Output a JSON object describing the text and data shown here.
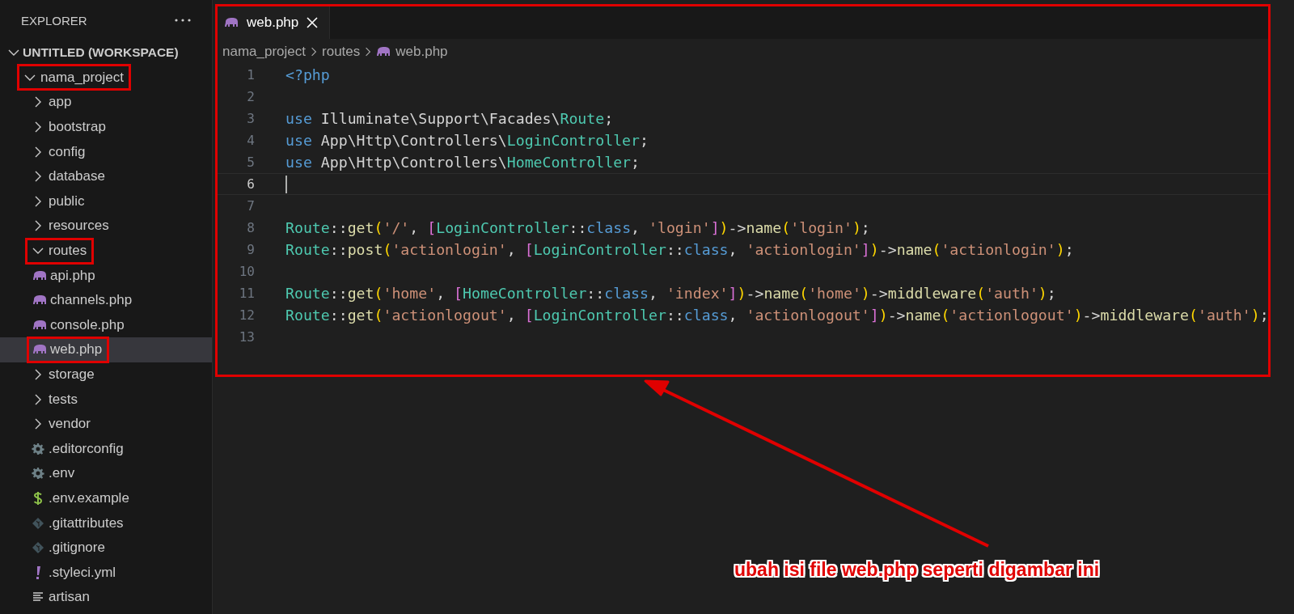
{
  "sidebar": {
    "title": "EXPLORER",
    "workspace": {
      "label": "UNTITLED (WORKSPACE)",
      "expanded": true
    },
    "tree": [
      {
        "label": "nama_project",
        "kind": "folder",
        "expanded": true,
        "selected": false,
        "highlighted": true,
        "children": [
          {
            "label": "app",
            "kind": "folder",
            "expanded": false,
            "selected": false,
            "highlighted": false
          },
          {
            "label": "bootstrap",
            "kind": "folder",
            "expanded": false,
            "selected": false,
            "highlighted": false
          },
          {
            "label": "config",
            "kind": "folder",
            "expanded": false,
            "selected": false,
            "highlighted": false
          },
          {
            "label": "database",
            "kind": "folder",
            "expanded": false,
            "selected": false,
            "highlighted": false
          },
          {
            "label": "public",
            "kind": "folder",
            "expanded": false,
            "selected": false,
            "highlighted": false
          },
          {
            "label": "resources",
            "kind": "folder",
            "expanded": false,
            "selected": false,
            "highlighted": false
          },
          {
            "label": "routes",
            "kind": "folder",
            "expanded": true,
            "selected": false,
            "highlighted": true,
            "children": [
              {
                "label": "api.php",
                "kind": "php",
                "selected": false,
                "highlighted": false
              },
              {
                "label": "channels.php",
                "kind": "php",
                "selected": false,
                "highlighted": false
              },
              {
                "label": "console.php",
                "kind": "php",
                "selected": false,
                "highlighted": false
              },
              {
                "label": "web.php",
                "kind": "php",
                "selected": true,
                "highlighted": true
              }
            ]
          },
          {
            "label": "storage",
            "kind": "folder",
            "expanded": false,
            "selected": false,
            "highlighted": false
          },
          {
            "label": "tests",
            "kind": "folder",
            "expanded": false,
            "selected": false,
            "highlighted": false
          },
          {
            "label": "vendor",
            "kind": "folder",
            "expanded": false,
            "selected": false,
            "highlighted": false
          },
          {
            "label": ".editorconfig",
            "kind": "config",
            "selected": false,
            "highlighted": false
          },
          {
            "label": ".env",
            "kind": "config",
            "selected": false,
            "highlighted": false
          },
          {
            "label": ".env.example",
            "kind": "env",
            "selected": false,
            "highlighted": false
          },
          {
            "label": ".gitattributes",
            "kind": "git",
            "selected": false,
            "highlighted": false
          },
          {
            "label": ".gitignore",
            "kind": "git",
            "selected": false,
            "highlighted": false
          },
          {
            "label": ".styleci.yml",
            "kind": "yaml",
            "selected": false,
            "highlighted": false
          },
          {
            "label": "artisan",
            "kind": "text",
            "selected": false,
            "highlighted": false
          }
        ]
      }
    ]
  },
  "editor": {
    "highlighted": true,
    "tabs": [
      {
        "label": "web.php",
        "selected": true
      }
    ],
    "breadcrumb": [
      "nama_project",
      "routes",
      "web.php"
    ],
    "lines": [
      {
        "number": "1",
        "current": false,
        "tokens": [
          {
            "kind": "keyword",
            "text": "<?php"
          }
        ]
      },
      {
        "number": "2",
        "current": false
      },
      {
        "number": "3",
        "current": false,
        "tokens": [
          {
            "kind": "keyword",
            "text": "use"
          },
          {
            "kind": "plain",
            "text": " Illuminate\\Support\\Facades\\"
          },
          {
            "kind": "class",
            "text": "Route"
          },
          {
            "kind": "plain",
            "text": ";"
          }
        ]
      },
      {
        "number": "4",
        "current": false,
        "tokens": [
          {
            "kind": "keyword",
            "text": "use"
          },
          {
            "kind": "plain",
            "text": " App\\Http\\Controllers\\"
          },
          {
            "kind": "class",
            "text": "LoginController"
          },
          {
            "kind": "plain",
            "text": ";"
          }
        ]
      },
      {
        "number": "5",
        "current": false,
        "tokens": [
          {
            "kind": "keyword",
            "text": "use"
          },
          {
            "kind": "plain",
            "text": " App\\Http\\Controllers\\"
          },
          {
            "kind": "class",
            "text": "HomeController"
          },
          {
            "kind": "plain",
            "text": ";"
          }
        ]
      },
      {
        "number": "6",
        "current": true
      },
      {
        "number": "7",
        "current": false
      },
      {
        "number": "8",
        "current": false,
        "tokens": [
          {
            "kind": "class",
            "text": "Route"
          },
          {
            "kind": "plain",
            "text": "::"
          },
          {
            "kind": "func",
            "text": "get"
          },
          {
            "kind": "paren",
            "text": "("
          },
          {
            "kind": "string",
            "text": "'/'"
          },
          {
            "kind": "plain",
            "text": ", "
          },
          {
            "kind": "bracket",
            "text": "["
          },
          {
            "kind": "class",
            "text": "LoginController"
          },
          {
            "kind": "plain",
            "text": "::"
          },
          {
            "kind": "keyword",
            "text": "class"
          },
          {
            "kind": "plain",
            "text": ", "
          },
          {
            "kind": "string",
            "text": "'login'"
          },
          {
            "kind": "bracket",
            "text": "]"
          },
          {
            "kind": "paren",
            "text": ")"
          },
          {
            "kind": "plain",
            "text": "->"
          },
          {
            "kind": "func",
            "text": "name"
          },
          {
            "kind": "paren",
            "text": "("
          },
          {
            "kind": "string",
            "text": "'login'"
          },
          {
            "kind": "paren",
            "text": ")"
          },
          {
            "kind": "plain",
            "text": ";"
          }
        ]
      },
      {
        "number": "9",
        "current": false,
        "tokens": [
          {
            "kind": "class",
            "text": "Route"
          },
          {
            "kind": "plain",
            "text": "::"
          },
          {
            "kind": "func",
            "text": "post"
          },
          {
            "kind": "paren",
            "text": "("
          },
          {
            "kind": "string",
            "text": "'actionlogin'"
          },
          {
            "kind": "plain",
            "text": ", "
          },
          {
            "kind": "bracket",
            "text": "["
          },
          {
            "kind": "class",
            "text": "LoginController"
          },
          {
            "kind": "plain",
            "text": "::"
          },
          {
            "kind": "keyword",
            "text": "class"
          },
          {
            "kind": "plain",
            "text": ", "
          },
          {
            "kind": "string",
            "text": "'actionlogin'"
          },
          {
            "kind": "bracket",
            "text": "]"
          },
          {
            "kind": "paren",
            "text": ")"
          },
          {
            "kind": "plain",
            "text": "->"
          },
          {
            "kind": "func",
            "text": "name"
          },
          {
            "kind": "paren",
            "text": "("
          },
          {
            "kind": "string",
            "text": "'actionlogin'"
          },
          {
            "kind": "paren",
            "text": ")"
          },
          {
            "kind": "plain",
            "text": ";"
          }
        ]
      },
      {
        "number": "10",
        "current": false
      },
      {
        "number": "11",
        "current": false,
        "tokens": [
          {
            "kind": "class",
            "text": "Route"
          },
          {
            "kind": "plain",
            "text": "::"
          },
          {
            "kind": "func",
            "text": "get"
          },
          {
            "kind": "paren",
            "text": "("
          },
          {
            "kind": "string",
            "text": "'home'"
          },
          {
            "kind": "plain",
            "text": ", "
          },
          {
            "kind": "bracket",
            "text": "["
          },
          {
            "kind": "class",
            "text": "HomeController"
          },
          {
            "kind": "plain",
            "text": "::"
          },
          {
            "kind": "keyword",
            "text": "class"
          },
          {
            "kind": "plain",
            "text": ", "
          },
          {
            "kind": "string",
            "text": "'index'"
          },
          {
            "kind": "bracket",
            "text": "]"
          },
          {
            "kind": "paren",
            "text": ")"
          },
          {
            "kind": "plain",
            "text": "->"
          },
          {
            "kind": "func",
            "text": "name"
          },
          {
            "kind": "paren",
            "text": "("
          },
          {
            "kind": "string",
            "text": "'home'"
          },
          {
            "kind": "paren",
            "text": ")"
          },
          {
            "kind": "plain",
            "text": "->"
          },
          {
            "kind": "func",
            "text": "middleware"
          },
          {
            "kind": "paren",
            "text": "("
          },
          {
            "kind": "string",
            "text": "'auth'"
          },
          {
            "kind": "paren",
            "text": ")"
          },
          {
            "kind": "plain",
            "text": ";"
          }
        ]
      },
      {
        "number": "12",
        "current": false,
        "tokens": [
          {
            "kind": "class",
            "text": "Route"
          },
          {
            "kind": "plain",
            "text": "::"
          },
          {
            "kind": "func",
            "text": "get"
          },
          {
            "kind": "paren",
            "text": "("
          },
          {
            "kind": "string",
            "text": "'actionlogout'"
          },
          {
            "kind": "plain",
            "text": ", "
          },
          {
            "kind": "bracket",
            "text": "["
          },
          {
            "kind": "class",
            "text": "LoginController"
          },
          {
            "kind": "plain",
            "text": "::"
          },
          {
            "kind": "keyword",
            "text": "class"
          },
          {
            "kind": "plain",
            "text": ", "
          },
          {
            "kind": "string",
            "text": "'actionlogout'"
          },
          {
            "kind": "bracket",
            "text": "]"
          },
          {
            "kind": "paren",
            "text": ")"
          },
          {
            "kind": "plain",
            "text": "->"
          },
          {
            "kind": "func",
            "text": "name"
          },
          {
            "kind": "paren",
            "text": "("
          },
          {
            "kind": "string",
            "text": "'actionlogout'"
          },
          {
            "kind": "paren",
            "text": ")"
          },
          {
            "kind": "plain",
            "text": "->"
          },
          {
            "kind": "func",
            "text": "middleware"
          },
          {
            "kind": "paren",
            "text": "("
          },
          {
            "kind": "string",
            "text": "'auth'"
          },
          {
            "kind": "paren",
            "text": ")"
          },
          {
            "kind": "plain",
            "text": ";"
          }
        ]
      },
      {
        "number": "13",
        "current": false
      }
    ]
  },
  "annotation": {
    "caption": "ubah isi file web.php seperti digambar ini"
  }
}
